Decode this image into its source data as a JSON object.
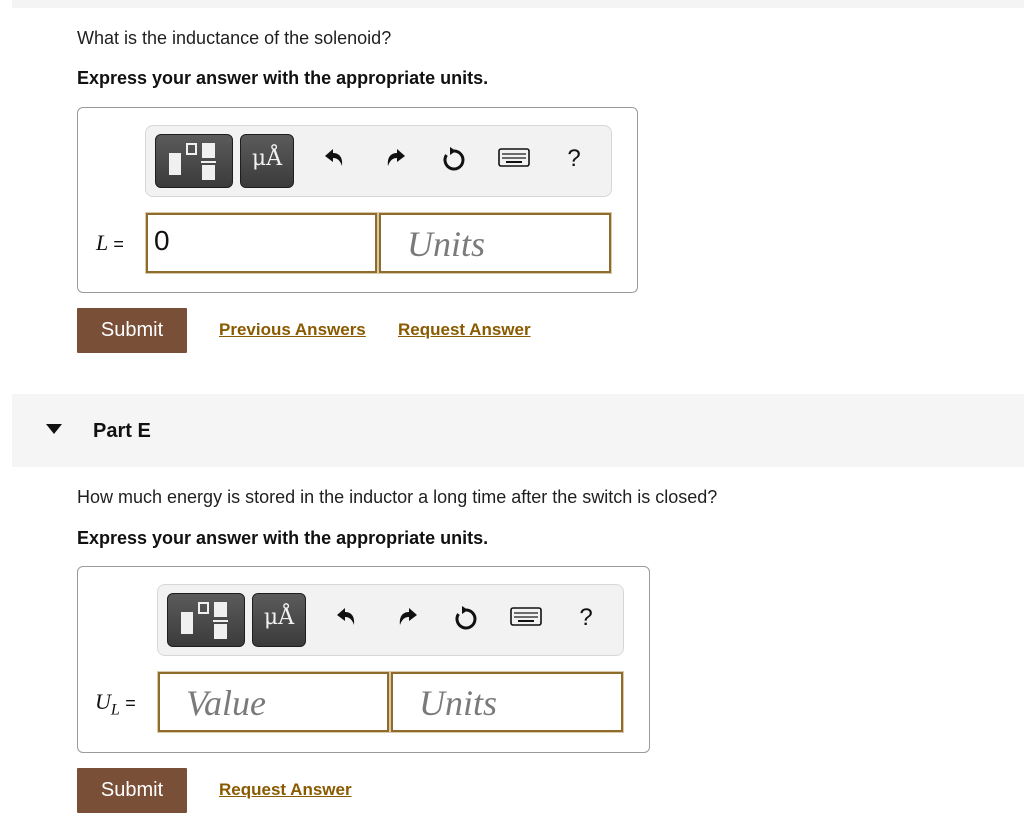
{
  "partD": {
    "question": "What is the inductance of the solenoid?",
    "instruction": "Express your answer with the appropriate units.",
    "toolbar": {
      "units_glyph": "μÅ",
      "help_glyph": "?"
    },
    "variable": {
      "symbol": "L",
      "equals": "="
    },
    "value_input": {
      "value": "0"
    },
    "units_input": {
      "placeholder": "Units"
    },
    "submit_label": "Submit",
    "links": [
      "Previous Answers",
      "Request Answer"
    ]
  },
  "partE": {
    "header": "Part E",
    "question": "How much energy is stored in the inductor a long time after the switch is closed?",
    "instruction": "Express your answer with the appropriate units.",
    "toolbar": {
      "units_glyph": "μÅ",
      "help_glyph": "?"
    },
    "variable": {
      "symbol": "U",
      "subscript": "L",
      "equals": "="
    },
    "value_input": {
      "placeholder": "Value"
    },
    "units_input": {
      "placeholder": "Units"
    },
    "submit_label": "Submit",
    "links": [
      "Request Answer"
    ]
  },
  "icons": [
    "templates-icon",
    "units-icon",
    "undo-icon",
    "redo-icon",
    "reset-icon",
    "keyboard-icon",
    "help-icon",
    "expand-caret-icon"
  ],
  "colors": {
    "submit_bg": "#7a4f37",
    "link": "#8a5a00",
    "field_border": "#8f6b2c"
  }
}
